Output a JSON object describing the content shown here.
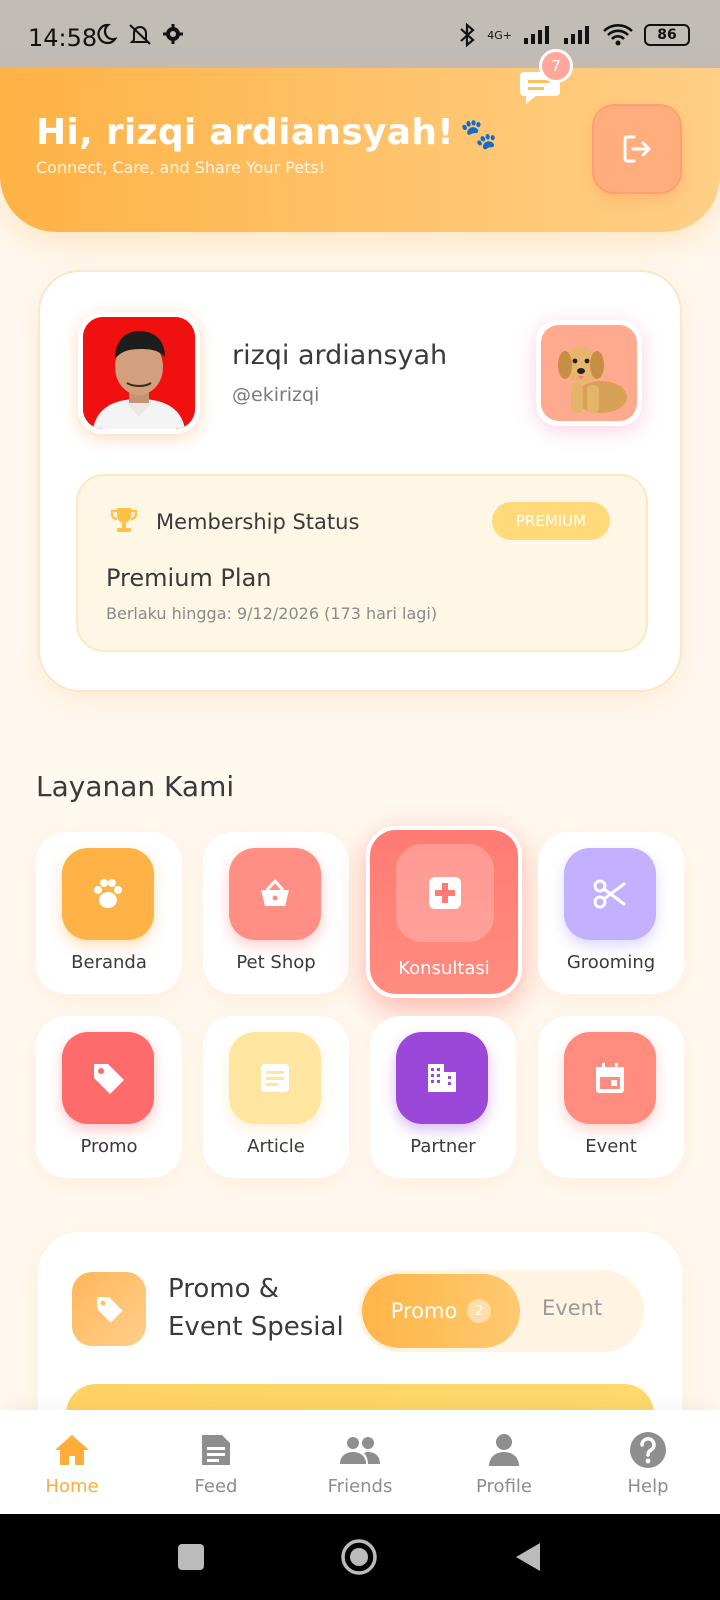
{
  "status_bar": {
    "time": "14:58",
    "network": "4G+",
    "battery": "86"
  },
  "header": {
    "greeting": "Hi, rizqi ardiansyah!",
    "greeting_emoji": "🐾",
    "tagline": "Connect, Care, and Share Your Pets!",
    "chat_badge_count": "7",
    "accent": "#ffb245"
  },
  "profile": {
    "name": "rizqi ardiansyah",
    "handle": "@ekirizqi",
    "membership": {
      "title": "Membership Status",
      "badge": "PREMIUM",
      "plan": "Premium Plan",
      "valid_until": "Berlaku hingga: 9/12/2026 (173 hari lagi)"
    }
  },
  "services": {
    "title": "Layanan Kami",
    "items": [
      {
        "label": "Beranda",
        "icon": "paw-icon",
        "color": "#ffb245"
      },
      {
        "label": "Pet Shop",
        "icon": "basket-icon",
        "color": "#ff8f84"
      },
      {
        "label": "Konsultasi",
        "icon": "medical-icon",
        "color": "#ff7b74"
      },
      {
        "label": "Grooming",
        "icon": "scissors-icon",
        "color": "#c3b0ff"
      },
      {
        "label": "Promo",
        "icon": "tag-icon",
        "color": "#ff6a6a"
      },
      {
        "label": "Article",
        "icon": "article-icon",
        "color": "#ffe6a0"
      },
      {
        "label": "Partner",
        "icon": "building-icon",
        "color": "#9b47d8"
      },
      {
        "label": "Event",
        "icon": "calendar-icon",
        "color": "#ff8c7e"
      }
    ]
  },
  "promo_section": {
    "title_line1": "Promo &",
    "title_line2": "Event Spesial",
    "tabs": {
      "promo_label": "Promo",
      "promo_count": "2",
      "event_label": "Event"
    }
  },
  "bottom_nav": {
    "items": [
      {
        "label": "Home",
        "icon": "home-icon"
      },
      {
        "label": "Feed",
        "icon": "feed-icon"
      },
      {
        "label": "Friends",
        "icon": "friends-icon"
      },
      {
        "label": "Profile",
        "icon": "profile-icon"
      },
      {
        "label": "Help",
        "icon": "help-icon"
      }
    ]
  }
}
